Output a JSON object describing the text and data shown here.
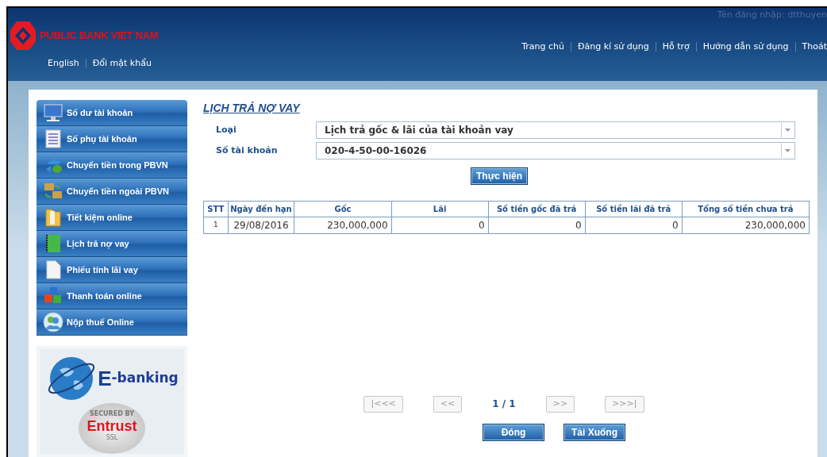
{
  "header": {
    "bank_name": "PUBLIC BANK VIET NAM",
    "login_info": "Tên đăng nhập: dtthuyen",
    "top_links": [
      "Trang chủ",
      "Đăng kí sử dụng",
      "Hỗ trợ",
      "Hướng dẫn sử dụng",
      "Thoát"
    ],
    "sub_links": [
      "English",
      "Đổi mật khẩu"
    ]
  },
  "sidebar": {
    "items": [
      {
        "label": "Số dư tài khoản"
      },
      {
        "label": "Số phụ tài khoản"
      },
      {
        "label": "Chuyển tiền trong PBVN"
      },
      {
        "label": "Chuyển tiền ngoài PBVN"
      },
      {
        "label": "Tiết kiệm online"
      },
      {
        "label": "Lịch trả nợ vay"
      },
      {
        "label": "Phiếu tính lãi vay"
      },
      {
        "label": "Thanh toán online"
      },
      {
        "label": "Nộp thuế Online"
      }
    ],
    "banner": {
      "ebanking": "-banking",
      "ebanking_letter": "E",
      "seal_text": "SECURED BY",
      "seal_brand": "Entrust",
      "seal_sub": "SSL"
    }
  },
  "page_title": "LỊCH TRẢ NỢ VAY",
  "form": {
    "fields": [
      {
        "label": "Loại",
        "value": "Lịch trả gốc & lãi của tài khoản vay"
      },
      {
        "label": "Số tài khoản",
        "value": "020-4-50-00-16026"
      }
    ],
    "submit": "Thực hiện"
  },
  "table": {
    "columns": [
      "STT",
      "Ngày đến hạn",
      "Gốc",
      "Lãi",
      "Số tiền gốc đã trả",
      "Số tiền lãi đã trả",
      "Tổng số tiền chưa trả"
    ],
    "rows": [
      [
        "1",
        "29/08/2016",
        "230,000,000",
        "0",
        "0",
        "0",
        "230,000,000"
      ]
    ]
  },
  "pager": {
    "buttons": [
      {
        "label": "|<<<",
        "disabled": true
      },
      {
        "label": "<<",
        "disabled": true
      },
      {
        "label": ">>",
        "disabled": true
      },
      {
        "label": ">>>|",
        "disabled": true
      }
    ],
    "page": "1 / 1"
  },
  "actions": [
    "Đóng",
    "Tải Xuống"
  ]
}
